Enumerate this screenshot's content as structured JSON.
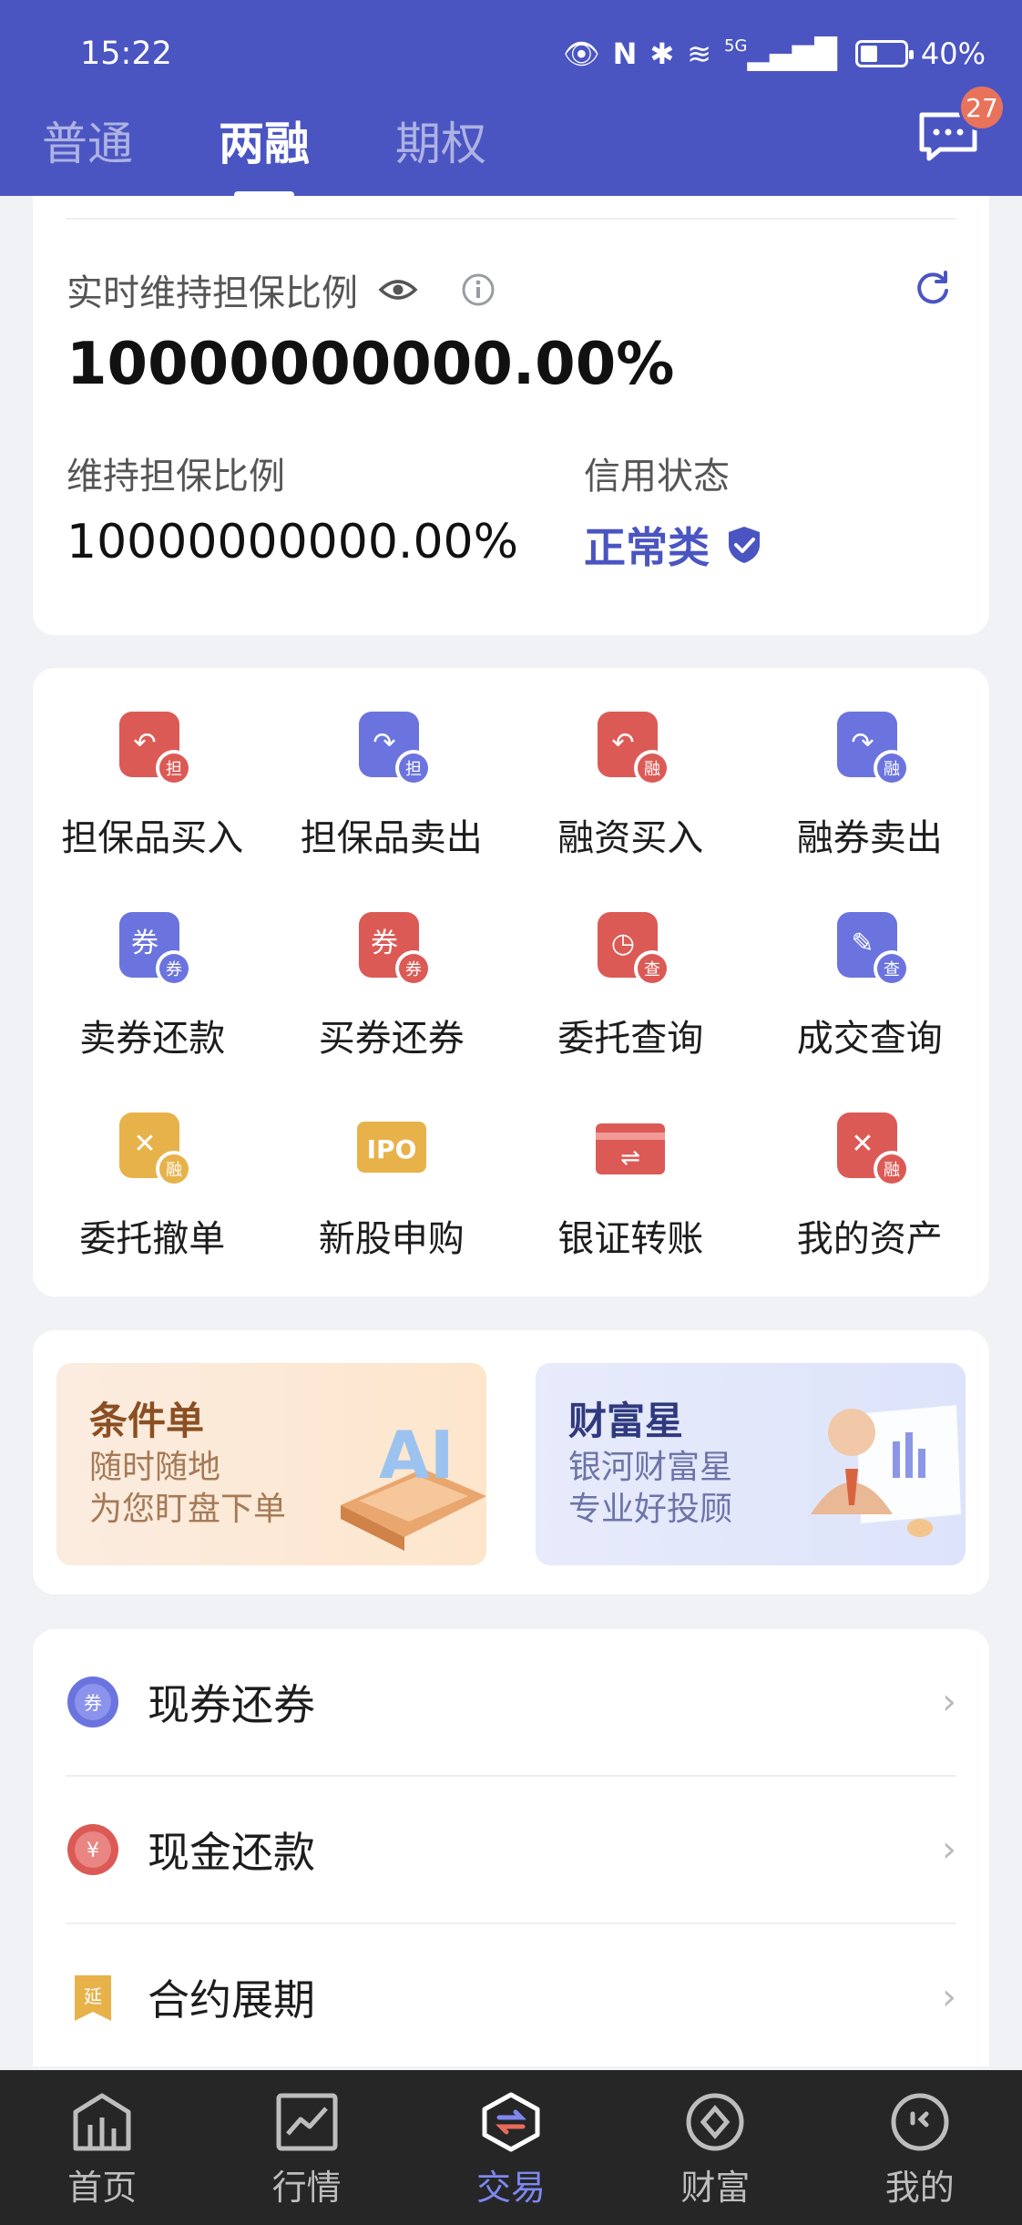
{
  "status_bar": {
    "time": "15:22",
    "signal": "5G",
    "battery": "40%"
  },
  "header": {
    "tabs": [
      {
        "label": "普通"
      },
      {
        "label": "两融"
      },
      {
        "label": "期权"
      }
    ],
    "message_badge": "27"
  },
  "ratio": {
    "realtime_label": "实时维持担保比例",
    "realtime_value": "10000000000.00%",
    "maintain_label": "维持担保比例",
    "maintain_value": "10000000000.00%",
    "credit_label": "信用状态",
    "credit_value": "正常类"
  },
  "functions": [
    {
      "label": "担保品买入",
      "icon": "collateral-buy-icon",
      "badge": "担"
    },
    {
      "label": "担保品卖出",
      "icon": "collateral-sell-icon",
      "badge": "担"
    },
    {
      "label": "融资买入",
      "icon": "margin-buy-icon",
      "badge": "融"
    },
    {
      "label": "融券卖出",
      "icon": "short-sell-icon",
      "badge": "融"
    },
    {
      "label": "卖券还款",
      "icon": "sell-repay-icon",
      "badge": "券"
    },
    {
      "label": "买券还券",
      "icon": "buy-return-icon",
      "badge": "券"
    },
    {
      "label": "委托查询",
      "icon": "order-query-icon",
      "badge": "查"
    },
    {
      "label": "成交查询",
      "icon": "trade-query-icon",
      "badge": "查"
    },
    {
      "label": "委托撤单",
      "icon": "cancel-order-icon",
      "badge": "融"
    },
    {
      "label": "新股申购",
      "icon": "ipo-icon",
      "badge": "IPO"
    },
    {
      "label": "银证转账",
      "icon": "bank-transfer-icon",
      "badge": "⇌"
    },
    {
      "label": "我的资产",
      "icon": "wallet-icon",
      "badge": "融"
    }
  ],
  "banners": [
    {
      "title": "条件单",
      "line1": "随时随地",
      "line2": "为您盯盘下单",
      "art": "AI"
    },
    {
      "title": "财富星",
      "line1": "银河财富星",
      "line2": "专业好投顾"
    }
  ],
  "list_rows": [
    {
      "label": "现券还券",
      "icon_char": "券"
    },
    {
      "label": "现金还款",
      "icon_char": "¥"
    },
    {
      "label": "合约展期",
      "icon_char": "延"
    }
  ],
  "bottom_nav": [
    {
      "label": "首页"
    },
    {
      "label": "行情"
    },
    {
      "label": "交易"
    },
    {
      "label": "财富"
    },
    {
      "label": "我的"
    }
  ],
  "colors": {
    "brand": "#4a55c2",
    "red": "#dc5a55",
    "blue": "#6b74de",
    "gold": "#e8b24a"
  }
}
